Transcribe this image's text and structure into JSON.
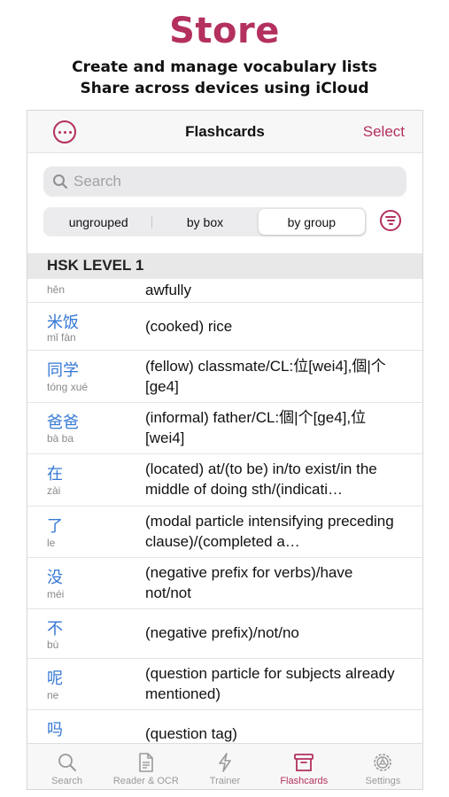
{
  "promo": {
    "title": "Store",
    "line1": "Create and manage vocabulary lists",
    "line2": "Share across devices using iCloud"
  },
  "navbar": {
    "title": "Flashcards",
    "select_label": "Select",
    "more_icon": "ellipsis-circle-icon"
  },
  "search": {
    "placeholder": "Search",
    "value": ""
  },
  "segments": [
    {
      "label": "ungrouped",
      "selected": false
    },
    {
      "label": "by box",
      "selected": false
    },
    {
      "label": "by group",
      "selected": true
    }
  ],
  "section": {
    "title": "HSK LEVEL 1"
  },
  "entries": [
    {
      "hanzi": "",
      "pinyin": "hěn",
      "definition": "awfully"
    },
    {
      "hanzi": "米饭",
      "pinyin": "mǐ fàn",
      "definition": "(cooked) rice"
    },
    {
      "hanzi": "同学",
      "pinyin": "tóng xué",
      "definition": "(fellow) classmate/CL:位[wei4],個|个[ge4]"
    },
    {
      "hanzi": "爸爸",
      "pinyin": "bà ba",
      "definition": "(informal) father/CL:個|个[ge4],位[wei4]"
    },
    {
      "hanzi": "在",
      "pinyin": "zài",
      "definition": "(located) at/(to be) in/to exist/in the middle of doing sth/(indicati…"
    },
    {
      "hanzi": "了",
      "pinyin": "le",
      "definition": "(modal particle intensifying preceding clause)/(completed a…"
    },
    {
      "hanzi": "没",
      "pinyin": "méi",
      "definition": "(negative prefix for verbs)/have not/not"
    },
    {
      "hanzi": "不",
      "pinyin": "bù",
      "definition": "(negative prefix)/not/no"
    },
    {
      "hanzi": "呢",
      "pinyin": "ne",
      "definition": "(question particle for subjects already mentioned)"
    },
    {
      "hanzi": "吗",
      "pinyin": "",
      "definition": "(question tag)"
    }
  ],
  "tabs": [
    {
      "label": "Search",
      "icon": "magnifier-icon",
      "active": false
    },
    {
      "label": "Reader & OCR",
      "icon": "document-icon",
      "active": false
    },
    {
      "label": "Trainer",
      "icon": "lightning-icon",
      "active": false
    },
    {
      "label": "Flashcards",
      "icon": "archive-box-icon",
      "active": true
    },
    {
      "label": "Settings",
      "icon": "gear-icon",
      "active": false
    }
  ],
  "colors": {
    "accent": "#b3305f",
    "link_blue": "#3478d4"
  }
}
